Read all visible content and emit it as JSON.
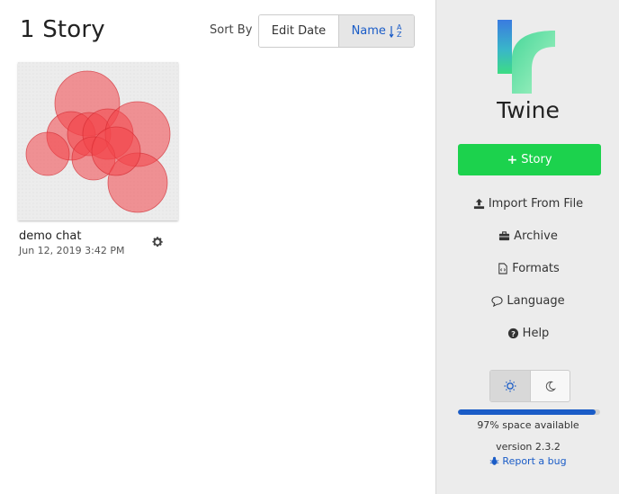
{
  "library": {
    "title": "1 Story",
    "sort": {
      "label": "Sort By",
      "edit_date_label": "Edit Date",
      "name_label": "Name",
      "name_icon_top": "A",
      "name_icon_bottom": "Z",
      "active": "name"
    }
  },
  "stories": [
    {
      "name": "demo chat",
      "date": "Jun 12, 2019 3:42 PM"
    }
  ],
  "sidebar": {
    "app_name": "Twine",
    "new_story_label": "Story",
    "items": [
      {
        "label": "Import From File",
        "icon": "upload-icon"
      },
      {
        "label": "Archive",
        "icon": "briefcase-icon"
      },
      {
        "label": "Formats",
        "icon": "file-code-icon"
      },
      {
        "label": "Language",
        "icon": "speech-bubble-icon"
      },
      {
        "label": "Help",
        "icon": "question-circle-icon"
      }
    ],
    "theme": {
      "active": "light"
    },
    "storage": {
      "percent_available": 97,
      "label": "97% space available"
    },
    "version": "version 2.3.2",
    "bug_link": "Report a bug"
  },
  "colors": {
    "accent": "#1a5cc7",
    "new_story_green": "#1cd24d",
    "preview_circle": "#f2454a"
  }
}
